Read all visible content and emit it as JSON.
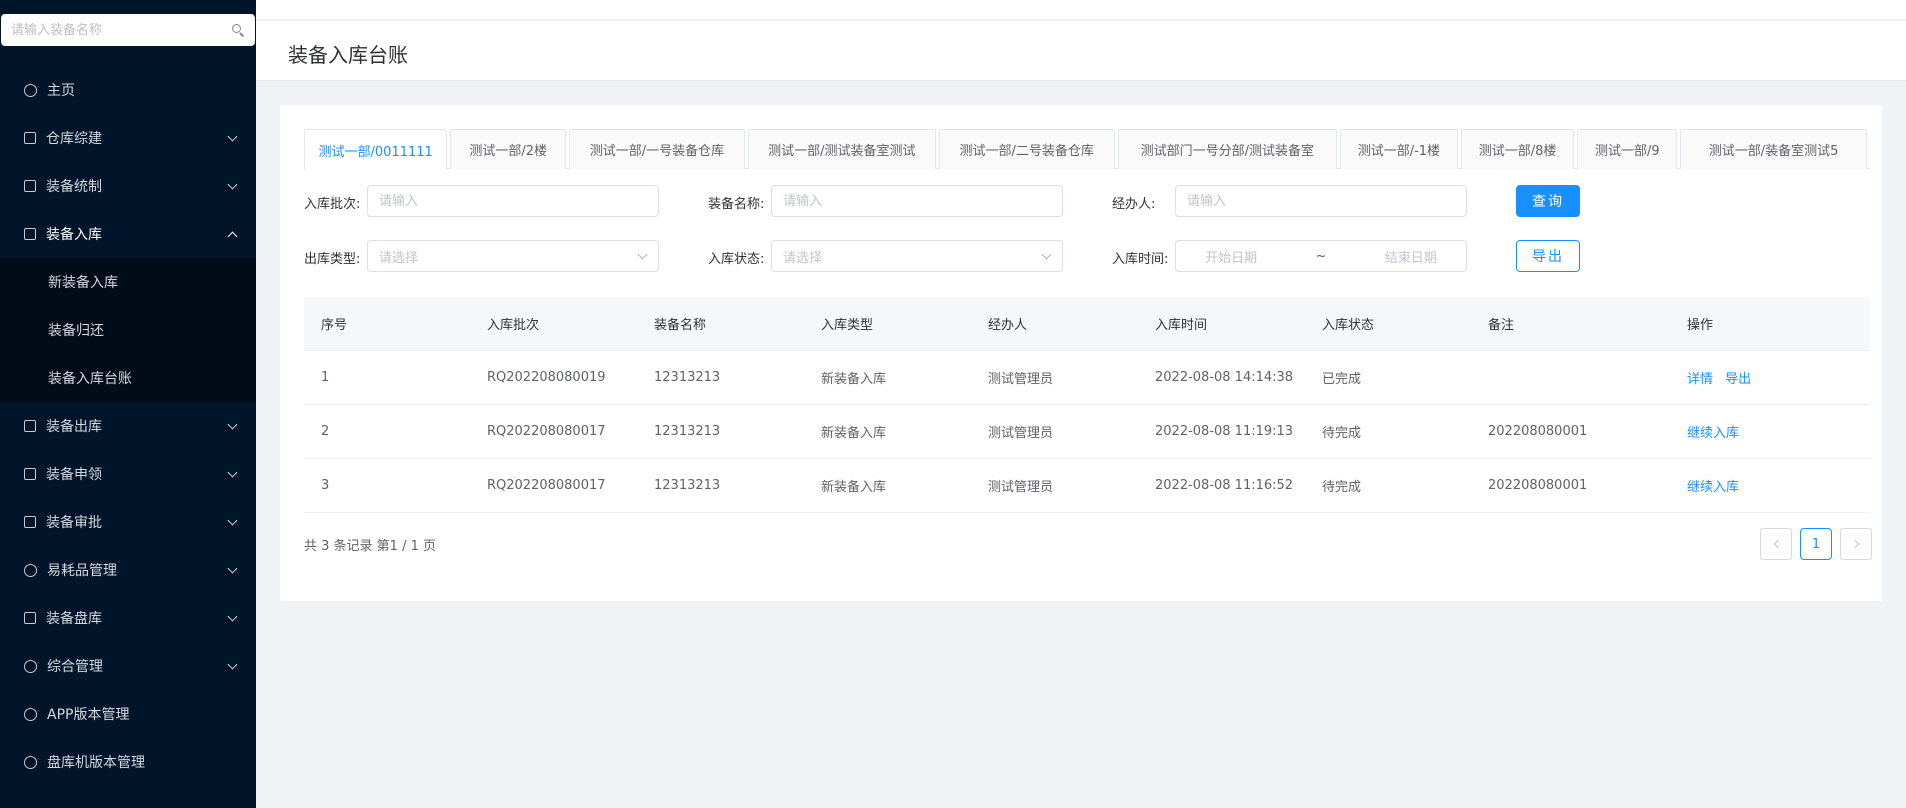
{
  "sidebar": {
    "search_placeholder": "请输入装备名称",
    "menu": [
      {
        "label": "主页",
        "icon": "globe-icon"
      },
      {
        "label": "仓库综建",
        "icon": "building-icon"
      },
      {
        "label": "装备统制",
        "icon": "document-icon"
      },
      {
        "label": "装备入库",
        "icon": "import-icon"
      },
      {
        "label": "装备出库",
        "icon": "export-icon"
      },
      {
        "label": "装备申领",
        "icon": "form-icon"
      },
      {
        "label": "装备审批",
        "icon": "approve-icon"
      },
      {
        "label": "易耗品管理",
        "icon": "rocket-icon"
      },
      {
        "label": "装备盘库",
        "icon": "inventory-icon"
      },
      {
        "label": "综合管理",
        "icon": "user-icon"
      },
      {
        "label": "APP版本管理",
        "icon": "android-icon"
      },
      {
        "label": "盘库机版本管理",
        "icon": "rocket-icon"
      }
    ],
    "submenu": [
      "新装备入库",
      "装备归还",
      "装备入库台账"
    ]
  },
  "page": {
    "title": "装备入库台账"
  },
  "tabs": [
    "测试一部/0011111",
    "测试一部/2楼",
    "测试一部/一号装备仓库",
    "测试一部/测试装备室测试",
    "测试一部/二号装备仓库",
    "测试部门一号分部/测试装备室",
    "测试一部/-1楼",
    "测试一部/8楼",
    "测试一部/9",
    "测试一部/装备室测试5"
  ],
  "filters": {
    "batch_label": "入库批次:",
    "batch_placeholder": "请输入",
    "name_label": "装备名称:",
    "name_placeholder": "请输入",
    "handler_label": "经办人:",
    "handler_placeholder": "请输入",
    "type_label": "出库类型:",
    "type_placeholder": "请选择",
    "status_label": "入库状态:",
    "status_placeholder": "请选择",
    "time_label": "入库时间:",
    "start_placeholder": "开始日期",
    "range_sep": "~",
    "end_placeholder": "结束日期",
    "query_button": "查询",
    "export_button": "导出"
  },
  "table": {
    "headers": [
      "序号",
      "入库批次",
      "装备名称",
      "入库类型",
      "经办人",
      "入库时间",
      "入库状态",
      "备注",
      "操作"
    ],
    "rows": [
      {
        "no": "1",
        "batch": "RQ202208080019",
        "name": "12313213",
        "type": "新装备入库",
        "handler": "测试管理员",
        "time": "2022-08-08 14:14:38",
        "status": "已完成",
        "remark": "",
        "actions": [
          "详情",
          "导出"
        ]
      },
      {
        "no": "2",
        "batch": "RQ202208080017",
        "name": "12313213",
        "type": "新装备入库",
        "handler": "测试管理员",
        "time": "2022-08-08 11:19:13",
        "status": "待完成",
        "remark": "202208080001",
        "actions": [
          "继续入库"
        ]
      },
      {
        "no": "3",
        "batch": "RQ202208080017",
        "name": "12313213",
        "type": "新装备入库",
        "handler": "测试管理员",
        "time": "2022-08-08 11:16:52",
        "status": "待完成",
        "remark": "202208080001",
        "actions": [
          "继续入库"
        ]
      }
    ]
  },
  "pagination": {
    "summary": "共 3 条记录 第1 / 1 页",
    "current": "1"
  },
  "colors": {
    "sidebar_bg": "#001529",
    "submenu_bg": "#000c17",
    "primary": "#1890ff"
  }
}
